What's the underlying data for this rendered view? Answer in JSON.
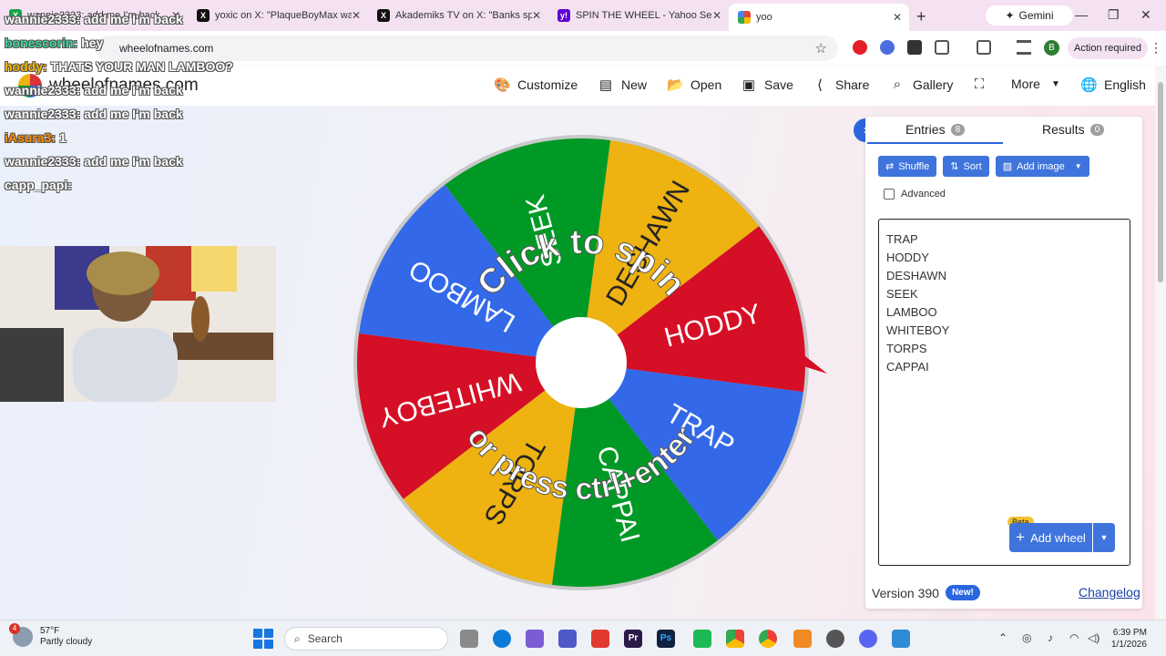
{
  "browser": {
    "tabs": [
      {
        "title": "wannie2333: add me I'm back",
        "favicon": "x-logo-icon",
        "active": false
      },
      {
        "title": "yoxic on X: \"PlaqueBoyMax was",
        "favicon": "x-logo-icon",
        "active": false
      },
      {
        "title": "Akademiks TV on X: \"Banks spe",
        "favicon": "x-logo-icon",
        "active": false
      },
      {
        "title": "SPIN THE WHEEL - Yahoo Searc",
        "favicon": "yahoo-icon",
        "active": false
      },
      {
        "title": "yoo",
        "favicon": "google-icon",
        "active": true
      }
    ],
    "new_tab": "+",
    "gemini_label": "Gemini",
    "url": "wheelofnames.com",
    "action_required": "Action required",
    "profile_initial": "B"
  },
  "site": {
    "logo_text": "wheelofnames.com",
    "nav": [
      {
        "label": "Customize",
        "icon": "palette-icon"
      },
      {
        "label": "New",
        "icon": "file-icon"
      },
      {
        "label": "Open",
        "icon": "folder-open-icon"
      },
      {
        "label": "Save",
        "icon": "floppy-disk-icon"
      },
      {
        "label": "Share",
        "icon": "share-icon"
      },
      {
        "label": "Gallery",
        "icon": "search-icon"
      },
      {
        "label": "",
        "icon": "fullscreen-icon"
      },
      {
        "label": "More",
        "icon": "chevron-down-icon"
      },
      {
        "label": "English",
        "icon": "globe-icon"
      }
    ]
  },
  "wheel": {
    "segments": [
      {
        "label": "TRAP",
        "color": "#3369e8"
      },
      {
        "label": "CAPPAI",
        "color": "#009925"
      },
      {
        "label": "TORPS",
        "color": "#eeb211"
      },
      {
        "label": "WHITEBOY",
        "color": "#d50f25"
      },
      {
        "label": "LAMBOO",
        "color": "#3369e8"
      },
      {
        "label": "SEEK",
        "color": "#009925"
      },
      {
        "label": "DESHAWN",
        "color": "#eeb211"
      },
      {
        "label": "HODDY",
        "color": "#d50f25"
      }
    ],
    "top_text": "Click to spin",
    "bottom_text": "or press ctrl+enter",
    "pointer_color": "#d50f25"
  },
  "panel": {
    "entries_tab": "Entries",
    "entries_count": "8",
    "results_tab": "Results",
    "results_count": "0",
    "shuffle": "Shuffle",
    "sort": "Sort",
    "add_image": "Add image",
    "advanced": "Advanced",
    "entries": [
      "TRAP",
      "HODDY",
      "DESHAWN",
      "SEEK",
      "LAMBOO",
      "WHITEBOY",
      "TORPS",
      "CAPPAI"
    ],
    "beta": "Beta",
    "add_wheel": "Add wheel",
    "version": "Version 390",
    "new_badge": "New!",
    "changelog": "Changelog"
  },
  "overlay": {
    "chat": [
      {
        "name": "wannie2333:",
        "msg": "add me I'm back",
        "color": "#ffffff"
      },
      {
        "name": "bonescorin:",
        "msg": "hey",
        "color": "#3ad49a"
      },
      {
        "name": "hoddy:",
        "msg": "THATS YOUR MAN LAMBOO?",
        "color": "#f5b800"
      },
      {
        "name": "wannie2333:",
        "msg": "add me I'm back",
        "color": "#ffffff"
      },
      {
        "name": "wannie2333:",
        "msg": "add me I'm back",
        "color": "#ffffff"
      },
      {
        "name": "iAsura3:",
        "msg": "1",
        "color": "#ff8c00"
      },
      {
        "name": "wannie2333:",
        "msg": "add me I'm back",
        "color": "#ffffff"
      },
      {
        "name": "capp_papi:",
        "msg": "",
        "color": "#ffffff"
      }
    ]
  },
  "taskbar": {
    "temperature": "57°F",
    "condition": "Partly cloudy",
    "weather_badge": "4",
    "search_placeholder": "Search",
    "time": "6:39 PM",
    "date": "1/1/2026"
  }
}
